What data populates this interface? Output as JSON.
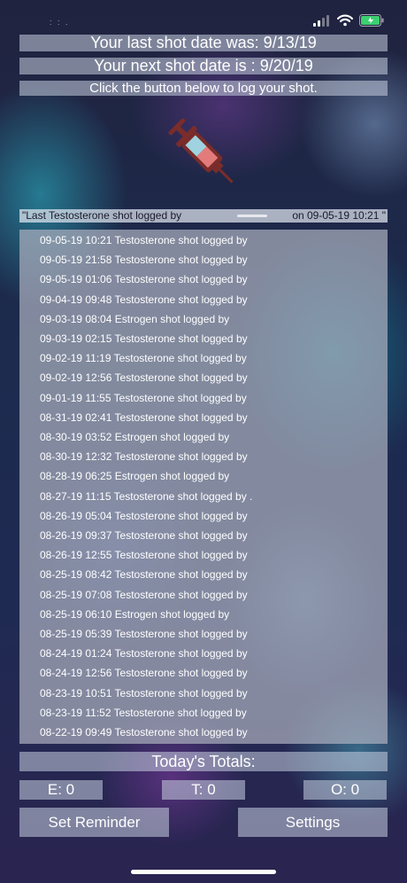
{
  "status_bar": {
    "carrier": ": : .",
    "battery_color": "#3cd070"
  },
  "header": {
    "last_shot_text": "Your last shot date was: 9/13/19",
    "next_shot_text": "Your next shot date is : 9/20/19",
    "instruction_text": "Click the button below to log your shot."
  },
  "log_button_icon": "syringe-icon",
  "last_logged": {
    "prefix": "\"Last Testosterone shot logged by",
    "suffix": "on 09-05-19 10:21 \""
  },
  "log_entries": [
    "09-05-19 10:21 Testosterone shot logged by",
    "09-05-19 21:58 Testosterone shot logged by",
    "09-05-19 01:06 Testosterone shot logged by",
    "09-04-19 09:48 Testosterone shot logged by",
    "09-03-19 08:04 Estrogen shot logged by",
    "09-03-19 02:15 Testosterone shot logged by",
    "09-02-19 11:19 Testosterone shot logged by",
    "09-02-19 12:56 Testosterone shot logged by",
    "09-01-19 11:55 Testosterone shot logged by",
    "08-31-19 02:41 Testosterone shot logged by",
    "08-30-19 03:52 Estrogen shot logged by",
    "08-30-19 12:32 Testosterone shot logged by",
    "08-28-19 06:25 Estrogen shot logged by",
    "08-27-19 11:15 Testosterone shot logged by .",
    "08-26-19 05:04 Testosterone shot logged by",
    "08-26-19 09:37 Testosterone shot logged by",
    "08-26-19 12:55 Testosterone shot logged by",
    "08-25-19 08:42 Testosterone shot logged by",
    "08-25-19 07:08 Testosterone shot logged by",
    "08-25-19 06:10 Estrogen shot logged by",
    "08-25-19 05:39 Testosterone shot logged by",
    "08-24-19 01:24 Testosterone shot logged by",
    "08-24-19 12:56 Testosterone shot logged by",
    "08-23-19 10:51 Testosterone shot logged by",
    "08-23-19 11:52 Testosterone shot logged by",
    "08-22-19 09:49 Testosterone shot logged by"
  ],
  "totals": {
    "title": "Today's Totals:",
    "e": "E: 0",
    "t": "T: 0",
    "o": "O: 0"
  },
  "actions": {
    "reminder_label": "Set Reminder",
    "settings_label": "Settings"
  }
}
